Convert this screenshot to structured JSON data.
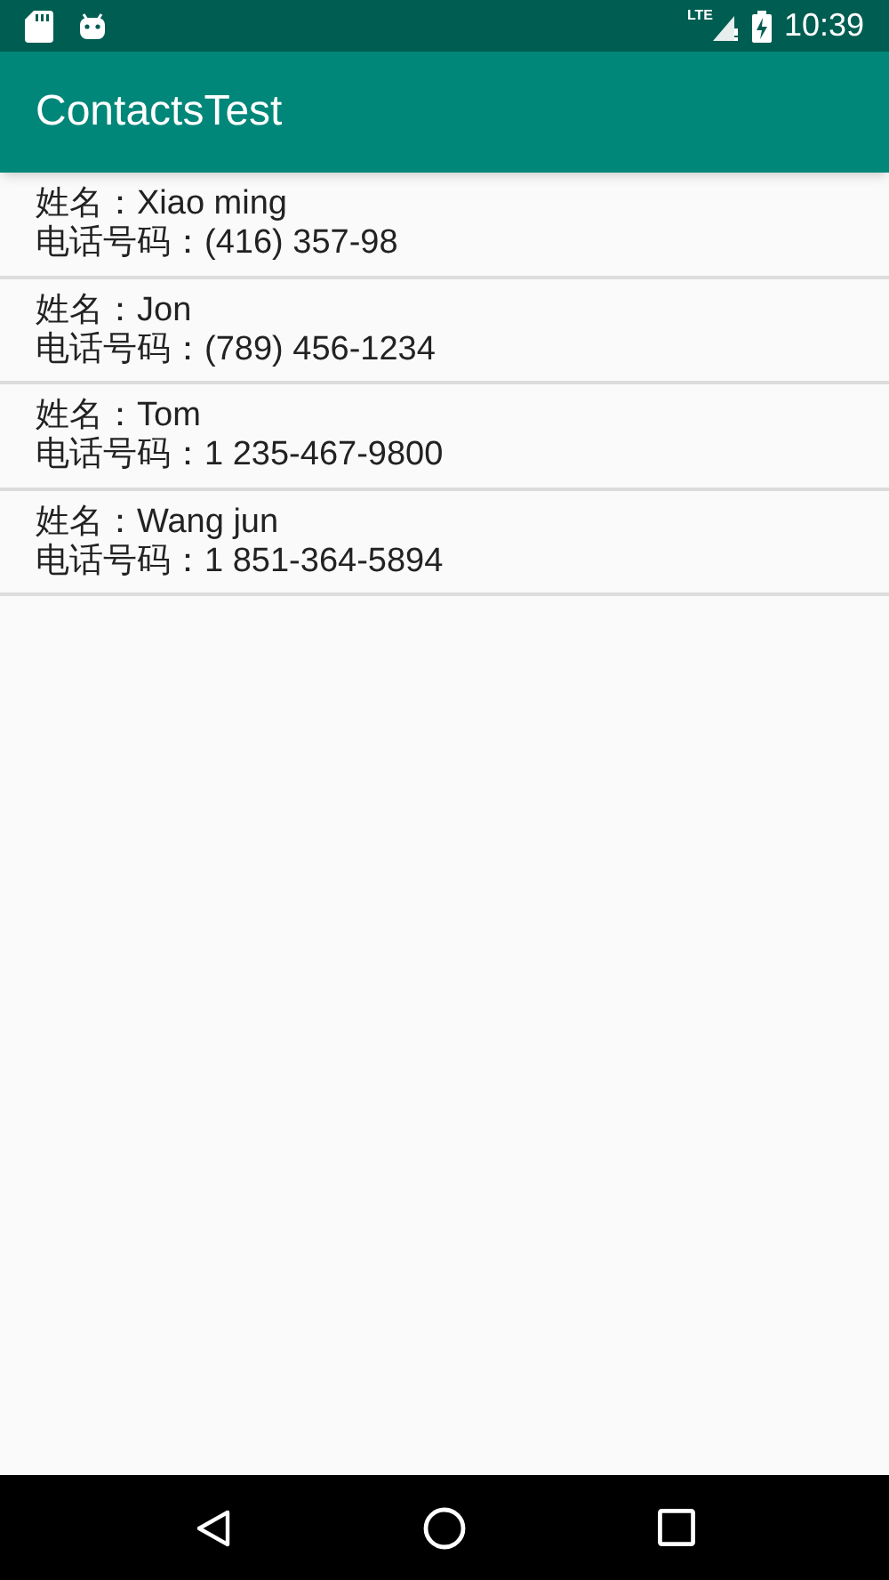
{
  "status_bar": {
    "network": "LTE",
    "time": "10:39"
  },
  "app_bar": {
    "title": "ContactsTest"
  },
  "contacts": [
    {
      "name": "姓名：Xiao ming",
      "phone": "电话号码：(416) 357-98"
    },
    {
      "name": "姓名：Jon",
      "phone": "电话号码：(789) 456-1234"
    },
    {
      "name": "姓名：Tom",
      "phone": "电话号码：1 235-467-9800"
    },
    {
      "name": "姓名：Wang jun",
      "phone": "电话号码：1 851-364-5894"
    }
  ]
}
